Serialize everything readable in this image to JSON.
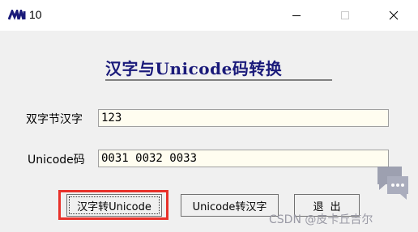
{
  "window": {
    "title": "10",
    "controls": {
      "minimize_icon": "minimize-icon",
      "maximize_icon": "maximize-icon",
      "close_icon": "close-icon"
    }
  },
  "heading": "汉字与Unicode码转换",
  "form": {
    "hanzi_label": "双字节汉字",
    "hanzi_value": "123",
    "unicode_label": "Unicode码",
    "unicode_value": "0031 0032 0033"
  },
  "buttons": {
    "to_unicode": "汉字转Unicode",
    "to_hanzi": "Unicode转汉字",
    "exit": "退出"
  },
  "watermark": {
    "text": "CSDN @皮卡丘吉尔"
  },
  "colors": {
    "heading": "#1a1a7a",
    "highlight_border": "#e8312a",
    "field_background": "#fffdf0",
    "window_background": "#f0f0f0"
  }
}
